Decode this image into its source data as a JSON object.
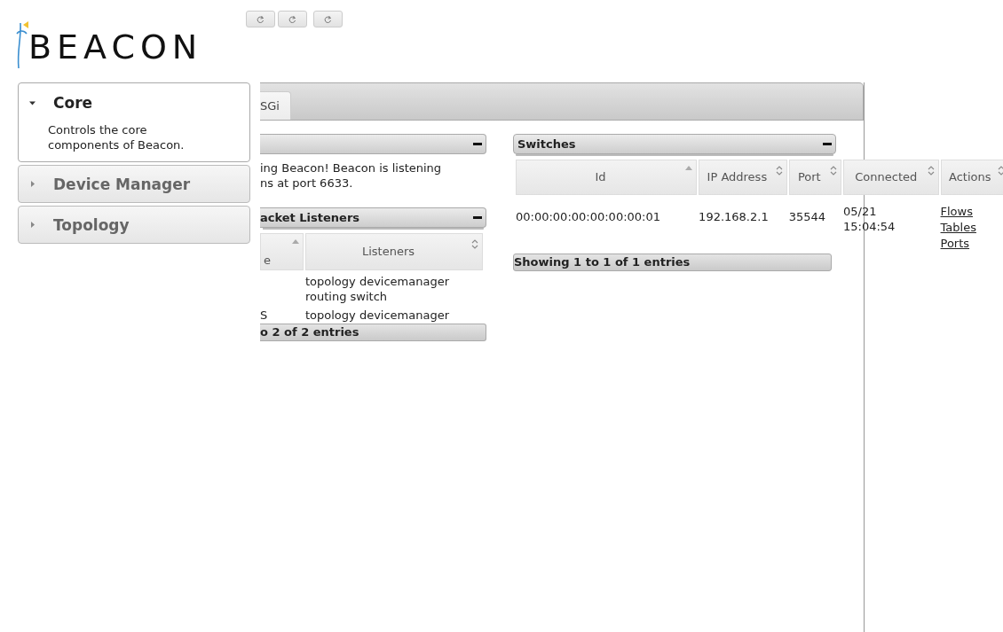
{
  "logo": {
    "text": "BEACON"
  },
  "toolbar": [
    {
      "kind": "refresh"
    },
    {
      "kind": "refresh"
    },
    {
      "kind": "refresh"
    }
  ],
  "sidebar": {
    "sections": [
      {
        "title": "Core",
        "expanded": true,
        "description": "Controls the core components of Beacon."
      },
      {
        "title": "Device Manager",
        "expanded": false
      },
      {
        "title": "Topology",
        "expanded": false
      }
    ]
  },
  "tabs": [
    {
      "label": "SGi",
      "selected": true
    }
  ],
  "left_panels": [
    {
      "kind": "text",
      "lines": [
        "ing Beacon! Beacon is listening",
        "ns at port 6633."
      ]
    },
    {
      "kind": "table",
      "title": "acket Listeners",
      "columns": [
        {
          "label": "e",
          "sorted": true
        },
        {
          "label": "Listeners",
          "sorted": false
        }
      ],
      "rows": [
        [
          null,
          "topology devicemanager routing switch"
        ],
        [
          "S",
          "topology devicemanager"
        ]
      ],
      "footer": "o 2 of 2 entries"
    }
  ],
  "switches": {
    "title": "Switches",
    "columns": [
      {
        "label": "Id",
        "sorted": true
      },
      {
        "label": "IP Address",
        "sorted": false
      },
      {
        "label": "Port",
        "sorted": false
      },
      {
        "label": "Connected",
        "sorted": false
      },
      {
        "label": "Actions",
        "sorted": false
      }
    ],
    "rows": [
      {
        "cells": [
          "00:00:00:00:00:00:00:01",
          "192.168.2.1",
          "35544",
          "05/21\n15:04:54"
        ],
        "links": [
          "Flows",
          "Tables",
          "Ports"
        ]
      }
    ],
    "footer": "Showing 1 to 1 of 1 entries"
  }
}
